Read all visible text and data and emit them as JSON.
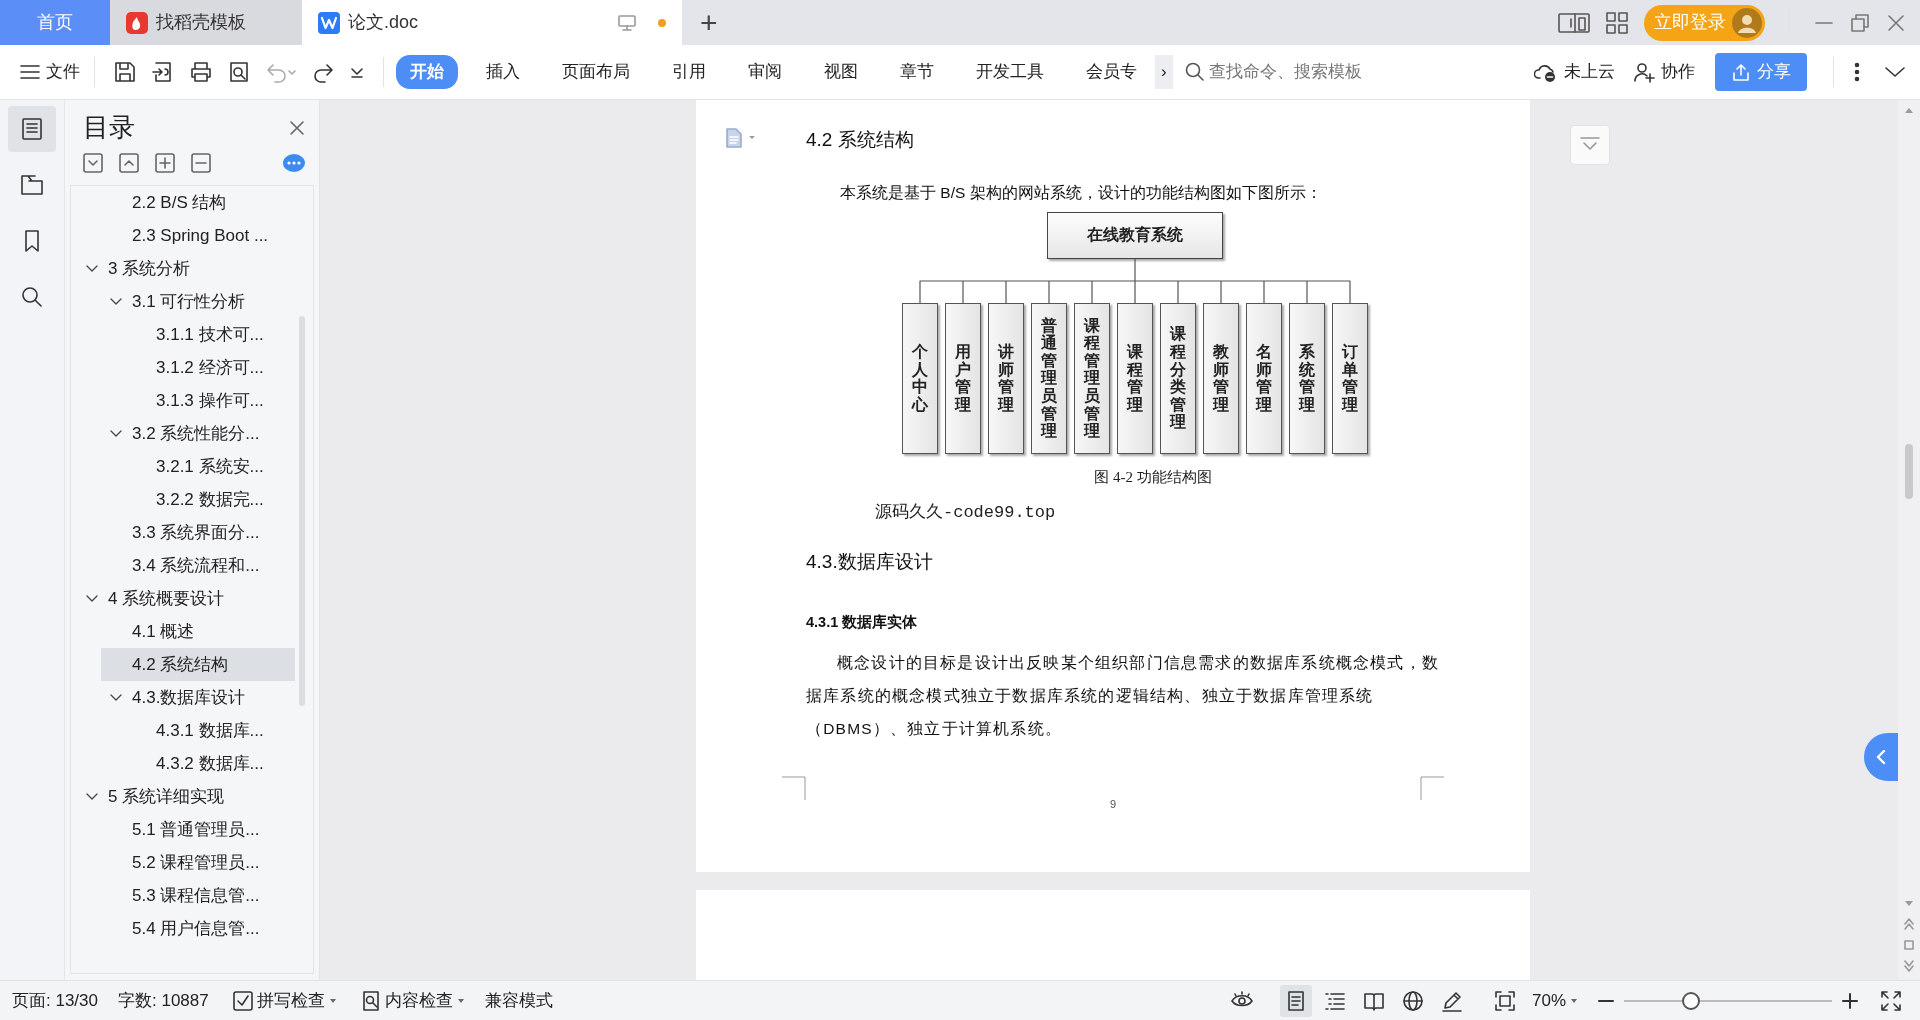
{
  "tabs": [
    {
      "label": "首页",
      "kind": "home",
      "selected": false
    },
    {
      "label": "找稻壳模板",
      "kind": "docer",
      "selected": false
    },
    {
      "label": "论文.doc",
      "kind": "document",
      "selected": true,
      "unsaved": true
    }
  ],
  "new_tab": "+",
  "login_button": "立即登录",
  "menu_button": "文件",
  "undo": {
    "disabled": true
  },
  "ribbon_tabs": [
    {
      "label": "开始",
      "selected": true
    },
    {
      "label": "插入",
      "selected": false
    },
    {
      "label": "页面布局",
      "selected": false
    },
    {
      "label": "引用",
      "selected": false
    },
    {
      "label": "审阅",
      "selected": false
    },
    {
      "label": "视图",
      "selected": false
    },
    {
      "label": "章节",
      "selected": false
    },
    {
      "label": "开发工具",
      "selected": false
    },
    {
      "label": "会员专",
      "selected": false
    }
  ],
  "ribbon_more": "›",
  "search": {
    "placeholder": "查找命令、搜索模板"
  },
  "cloud_status": "未上云",
  "collab": "协作",
  "share": "分享",
  "rail": [
    {
      "kind": "toc",
      "selected": true
    },
    {
      "kind": "navigation",
      "selected": false
    },
    {
      "kind": "bookmark",
      "selected": false
    },
    {
      "kind": "search",
      "selected": false
    }
  ],
  "toc": {
    "title": "目录",
    "items": [
      {
        "children": [
          {
            "label": "2.2 B/S 结构",
            "selected": false
          },
          {
            "label": "2.3 Spring Boot ...",
            "selected": false
          }
        ]
      },
      {
        "label": "3 系统分析",
        "selected": false,
        "expanded": true,
        "children": [
          {
            "label": "3.1 可行性分析",
            "selected": false,
            "expanded": true,
            "children": [
              {
                "label": "3.1.1 技术可...",
                "selected": false
              },
              {
                "label": "3.1.2 经济可...",
                "selected": false
              },
              {
                "label": "3.1.3 操作可...",
                "selected": false
              }
            ]
          },
          {
            "label": "3.2 系统性能分...",
            "selected": false,
            "expanded": true,
            "children": [
              {
                "label": "3.2.1  系统安...",
                "selected": false
              },
              {
                "label": "3.2.2  数据完...",
                "selected": false
              }
            ]
          },
          {
            "label": "3.3 系统界面分...",
            "selected": false
          },
          {
            "label": "3.4 系统流程和...",
            "selected": false
          }
        ]
      },
      {
        "label": "4 系统概要设计",
        "selected": false,
        "expanded": true,
        "children": [
          {
            "label": "4.1 概述",
            "selected": false
          },
          {
            "label": "4.2 系统结构",
            "selected": true
          },
          {
            "label": "4.3.数据库设计",
            "selected": false,
            "expanded": true,
            "children": [
              {
                "label": "4.3.1 数据库...",
                "selected": false
              },
              {
                "label": "4.3.2 数据库...",
                "selected": false
              }
            ]
          }
        ]
      },
      {
        "label": "5 系统详细实现",
        "selected": false,
        "expanded": true,
        "children": [
          {
            "label": "5.1  普通管理员...",
            "selected": false
          },
          {
            "label": "5.2  课程管理员...",
            "selected": false
          },
          {
            "label": "5.3  课程信息管...",
            "selected": false
          },
          {
            "label": "5.4  用户信息管...",
            "selected": false
          }
        ]
      }
    ]
  },
  "document": {
    "blocks": [
      {
        "kind": "heading",
        "text": "4.2 系统结构"
      },
      {
        "kind": "paragraph",
        "text": "本系统是基于 B/S 架构的网站系统，设计的功能结构图如下图所示："
      },
      {
        "kind": "diagram",
        "root": "在线教育系统",
        "children": [
          "个人中心",
          "用户管理",
          "讲师管理",
          "普通管理员管理",
          "课程管理员管理",
          "课程管理",
          "课程分类管理",
          "教师管理",
          "名师管理",
          "系统管理",
          "订单管理"
        ]
      },
      {
        "kind": "caption",
        "text": "图 4-2 功能结构图"
      },
      {
        "kind": "note",
        "text": "源码久久-code99.top"
      },
      {
        "kind": "heading",
        "text": "4.3.数据库设计"
      },
      {
        "kind": "subheading",
        "text": "4.3.1 数据库实体"
      },
      {
        "kind": "body",
        "text": "概念设计的目标是设计出反映某个组织部门信息需求的数据库系统概念模式，数据库系统的概念模式独立于数据库系统的逻辑结构、独立于数据库管理系统（DBMS）、独立于计算机系统。"
      }
    ],
    "page_number": "9"
  },
  "status": {
    "page": "页面: 13/30",
    "words": "字数: 10887",
    "spell_check": "拼写检查",
    "content_check": "内容检查",
    "compat": "兼容模式"
  },
  "view_modes": [
    {
      "kind": "eye",
      "selected": false
    },
    {
      "kind": "page",
      "selected": true
    },
    {
      "kind": "outline",
      "selected": false
    },
    {
      "kind": "book",
      "selected": false
    },
    {
      "kind": "web",
      "selected": false
    },
    {
      "kind": "pen",
      "selected": false
    }
  ],
  "zoom": {
    "value": "70%",
    "level": 0.32
  }
}
